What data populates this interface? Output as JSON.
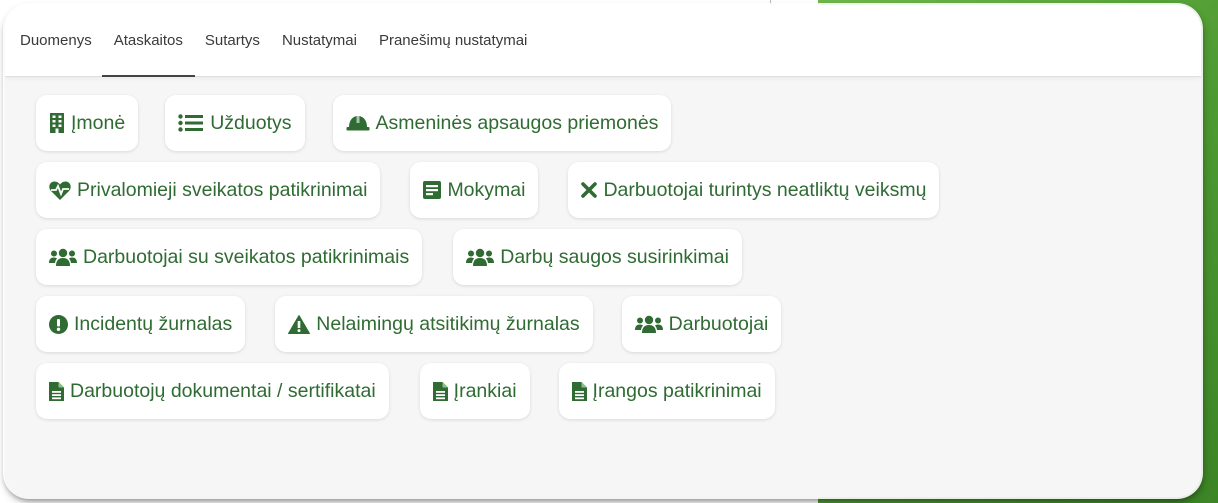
{
  "colors": {
    "accent": "#2f6b32",
    "background_green": "#4e9a32"
  },
  "tabs": [
    {
      "label": "Duomenys"
    },
    {
      "label": "Ataskaitos",
      "active": true
    },
    {
      "label": "Sutartys"
    },
    {
      "label": "Nustatymai"
    },
    {
      "label": "Pranešimų nustatymai"
    }
  ],
  "reports": {
    "imone": {
      "label": "Įmonė",
      "icon": "building-icon"
    },
    "uzduotys": {
      "label": "Užduotys",
      "icon": "list-icon"
    },
    "asmenines": {
      "label": "Asmeninės apsaugos priemonės",
      "icon": "hard-hat-icon"
    },
    "privalomieji": {
      "label": "Privalomieji sveikatos patikrinimai",
      "icon": "heartbeat-icon"
    },
    "mokymai": {
      "label": "Mokymai",
      "icon": "document-box-icon"
    },
    "neatliktu": {
      "label": "Darbuotojai turintys neatliktų veiksmų",
      "icon": "times-icon"
    },
    "su_sveikatos": {
      "label": "Darbuotojai su sveikatos patikrinimais",
      "icon": "users-icon"
    },
    "susirinkimai": {
      "label": "Darbų saugos susirinkimai",
      "icon": "users-icon"
    },
    "incidentu": {
      "label": "Incidentų žurnalas",
      "icon": "exclamation-circle-icon"
    },
    "nelaimingu": {
      "label": "Nelaimingų atsitikimų žurnalas",
      "icon": "warning-triangle-icon"
    },
    "darbuotojai": {
      "label": "Darbuotojai",
      "icon": "users-icon"
    },
    "dokumentai": {
      "label": "Darbuotojų dokumentai / sertifikatai",
      "icon": "file-icon"
    },
    "irankiai": {
      "label": "Įrankiai",
      "icon": "file-icon"
    },
    "irangos": {
      "label": "Įrangos patikrinimai",
      "icon": "file-icon"
    }
  }
}
